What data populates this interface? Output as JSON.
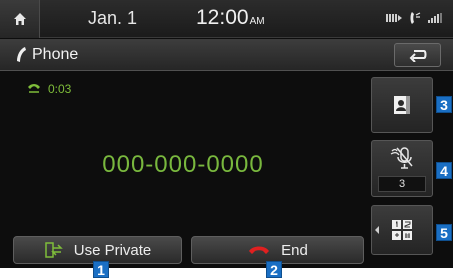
{
  "status": {
    "date": "Jan.  1",
    "time": "12:00",
    "ampm": "AM"
  },
  "title": {
    "label": "Phone"
  },
  "call": {
    "duration": "0:03",
    "number": "000-000-0000"
  },
  "mute": {
    "volume_level": "3"
  },
  "buttons": {
    "use_private": "Use Private",
    "end": "End"
  },
  "callouts": [
    "1",
    "2",
    "3",
    "4",
    "5"
  ],
  "colors": {
    "accent_green": "#79b83e",
    "end_red": "#e02020",
    "callout_blue": "#1a6fc4"
  }
}
